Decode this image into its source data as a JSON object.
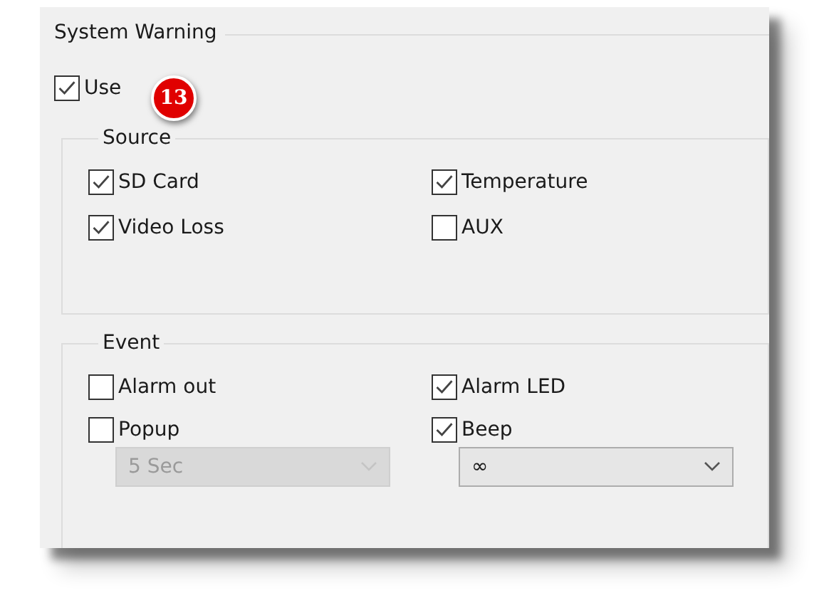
{
  "system_warning": {
    "title": "System Warning",
    "use": {
      "label": "Use",
      "checked": true
    },
    "badge": "13"
  },
  "source": {
    "title": "Source",
    "items": [
      {
        "label": "SD Card",
        "checked": true
      },
      {
        "label": "Temperature",
        "checked": true
      },
      {
        "label": "Video Loss",
        "checked": true
      },
      {
        "label": "AUX",
        "checked": false
      }
    ]
  },
  "event": {
    "title": "Event",
    "items": [
      {
        "label": "Alarm out",
        "checked": false
      },
      {
        "label": "Alarm LED",
        "checked": true
      },
      {
        "label": "Popup",
        "checked": false
      },
      {
        "label": "Beep",
        "checked": true
      }
    ],
    "dropdowns": [
      {
        "value": "5 Sec",
        "disabled": true
      },
      {
        "value": "∞",
        "disabled": false
      }
    ]
  }
}
